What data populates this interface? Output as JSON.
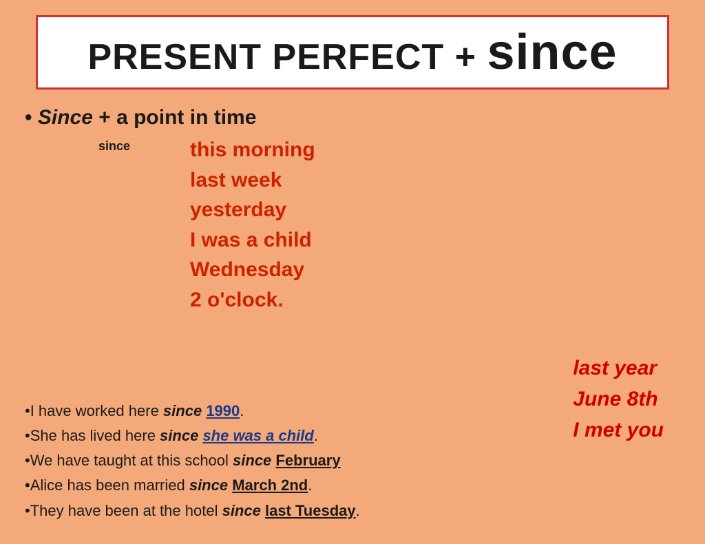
{
  "title": {
    "part1": "PRESENT PERFECT    + ",
    "part2": "since"
  },
  "bullet_heading": {
    "label": "Since + a point in time"
  },
  "since_label": "since",
  "examples": [
    "this morning",
    "last week",
    "yesterday",
    "I was a child",
    "Wednesday",
    "2 o'clock."
  ],
  "extra_examples": [
    "last year",
    "June 8th",
    "I met you"
  ],
  "sentences": [
    {
      "id": "s1",
      "prefix": "•I have worked here ",
      "since": "since",
      "highlight": "1990",
      "suffix": "."
    },
    {
      "id": "s2",
      "prefix": "•She has lived here ",
      "since": "since",
      "highlight": "she was a child",
      "suffix": "."
    },
    {
      "id": "s3",
      "prefix": "•We have taught at this school ",
      "since": "since",
      "highlight": "February",
      "suffix": ""
    },
    {
      "id": "s4",
      "prefix": "•Alice has been married ",
      "since": "since",
      "highlight": "March 2nd",
      "suffix": "."
    },
    {
      "id": "s5",
      "prefix": "•They have been at the hotel ",
      "since": "since",
      "highlight": "last Tuesday",
      "suffix": "."
    }
  ]
}
